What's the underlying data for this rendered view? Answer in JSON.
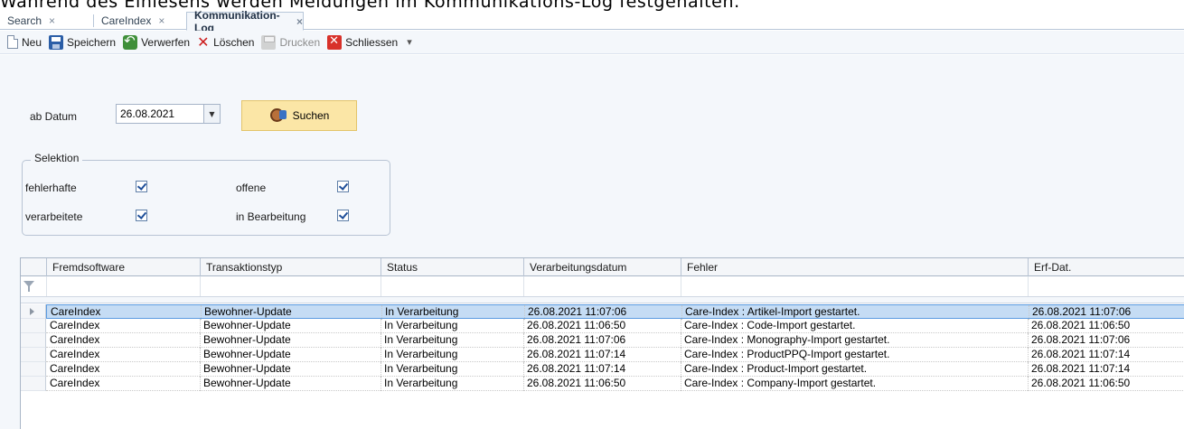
{
  "caption": "Während des Einlesens werden Meldungen im Kommunikations-Log festgehalten.",
  "tabs": [
    {
      "label": "Search",
      "close": "×"
    },
    {
      "label": "CareIndex",
      "close": "×"
    },
    {
      "label": "Kommunikation-Log",
      "close": "×"
    }
  ],
  "toolbar": {
    "new": "Neu",
    "save": "Speichern",
    "discard": "Verwerfen",
    "delete": "Löschen",
    "print": "Drucken",
    "close": "Schliessen",
    "overflow": "▾"
  },
  "filter": {
    "date_label": "ab Datum",
    "date_value": "26.08.2021",
    "date_dropdown": "▼",
    "search_button": "Suchen"
  },
  "selection": {
    "title": "Selektion",
    "faulty": {
      "label": "fehlerhafte",
      "checked": true
    },
    "open": {
      "label": "offene",
      "checked": true
    },
    "processed": {
      "label": "verarbeitete",
      "checked": true
    },
    "in_progress": {
      "label": "in Bearbeitung",
      "checked": true
    }
  },
  "grid": {
    "columns": [
      "Fremdsoftware",
      "Transaktionstyp",
      "Status",
      "Verarbeitungsdatum",
      "Fehler",
      "Erf-Dat."
    ],
    "rows": [
      [
        "CareIndex",
        "Bewohner-Update",
        "In Verarbeitung",
        "26.08.2021 11:07:06",
        "Care-Index : Artikel-Import gestartet.",
        "26.08.2021 11:07:06"
      ],
      [
        "CareIndex",
        "Bewohner-Update",
        "In Verarbeitung",
        "26.08.2021 11:06:50",
        "Care-Index : Code-Import gestartet.",
        "26.08.2021 11:06:50"
      ],
      [
        "CareIndex",
        "Bewohner-Update",
        "In Verarbeitung",
        "26.08.2021 11:07:06",
        "Care-Index : Monography-Import gestartet.",
        "26.08.2021 11:07:06"
      ],
      [
        "CareIndex",
        "Bewohner-Update",
        "In Verarbeitung",
        "26.08.2021 11:07:14",
        "Care-Index : ProductPPQ-Import gestartet.",
        "26.08.2021 11:07:14"
      ],
      [
        "CareIndex",
        "Bewohner-Update",
        "In Verarbeitung",
        "26.08.2021 11:07:14",
        "Care-Index : Product-Import gestartet.",
        "26.08.2021 11:07:14"
      ],
      [
        "CareIndex",
        "Bewohner-Update",
        "In Verarbeitung",
        "26.08.2021 11:06:50",
        "Care-Index : Company-Import gestartet.",
        "26.08.2021 11:06:50"
      ]
    ]
  },
  "colors": {
    "toolbar_bg": "#f4f7fb",
    "selected_row": "#c5dcf4",
    "search_button": "#fbe6a6"
  }
}
